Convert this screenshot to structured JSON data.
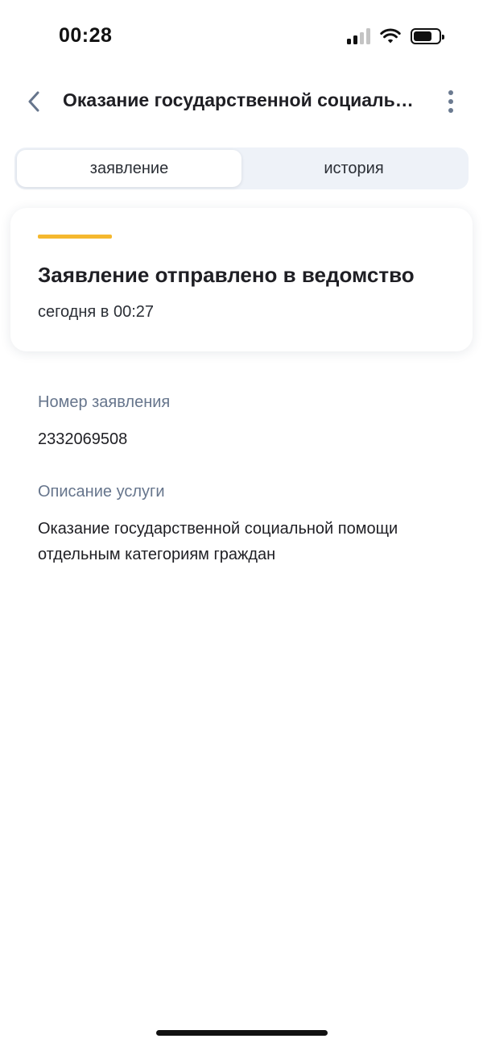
{
  "status_bar": {
    "time": "00:28",
    "icons": [
      "signal-icon",
      "wifi-icon",
      "battery-icon"
    ]
  },
  "header": {
    "back_icon": "chevron-left-icon",
    "title": "Оказание государственной социальной помощи отдельным категориям граждан",
    "more_icon": "more-vertical-icon"
  },
  "tabs": [
    {
      "label": "заявление",
      "active": true
    },
    {
      "label": "история",
      "active": false
    }
  ],
  "status_card": {
    "accent_color": "#f5b82e",
    "title": "Заявление отправлено в ведомство",
    "date": "сегодня в 00:27"
  },
  "fields": {
    "application_number": {
      "label": "Номер заявления",
      "value": "2332069508"
    },
    "service_description": {
      "label": "Описание услуги",
      "value_line1": "Оказание государственной социальной помощи",
      "value_line2": "отдельным категориям граждан"
    }
  },
  "colors": {
    "text_primary": "#1f1f24",
    "text_secondary": "#66758c",
    "tabs_background": "#eef2f8",
    "accent": "#f5b82e"
  }
}
